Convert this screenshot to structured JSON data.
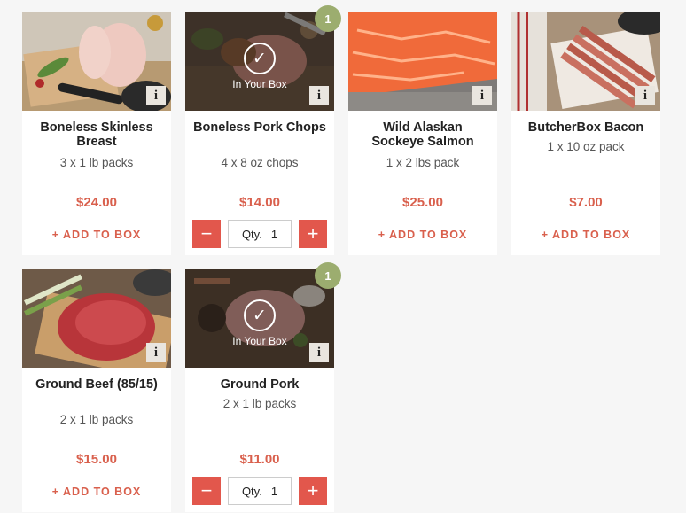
{
  "products": [
    {
      "name": "Boneless Skinless Breast",
      "pack": "3 x 1 lb packs",
      "price": "$24.00",
      "action": "+ ADD TO BOX",
      "info": "i"
    },
    {
      "name": "Boneless Pork Chops",
      "pack": "4 x 8 oz chops",
      "price": "$14.00",
      "badge": "1",
      "in_box": "In Your Box",
      "qty_label": "Qty.",
      "qty_value": "1",
      "info": "i"
    },
    {
      "name": "Wild Alaskan Sockeye Salmon",
      "pack": "1 x 2 lbs pack",
      "price": "$25.00",
      "action": "+ ADD TO BOX",
      "info": "i"
    },
    {
      "name": "ButcherBox Bacon",
      "pack": "1 x 10 oz pack",
      "price": "$7.00",
      "action": "+ ADD TO BOX",
      "info": "i"
    },
    {
      "name": "Ground Beef (85/15)",
      "pack": "2 x 1 lb packs",
      "price": "$15.00",
      "action": "+ ADD TO BOX",
      "info": "i"
    },
    {
      "name": "Ground Pork",
      "pack": "2 x 1 lb packs",
      "price": "$11.00",
      "badge": "1",
      "in_box": "In Your Box",
      "qty_label": "Qty.",
      "qty_value": "1",
      "info": "i"
    }
  ],
  "colors": {
    "accent": "#d9604d",
    "button": "#e2574c",
    "badge": "#9cad6f"
  },
  "icons": {
    "check": "check-icon",
    "info": "info-icon",
    "minus": "minus-icon",
    "plus": "plus-icon"
  }
}
